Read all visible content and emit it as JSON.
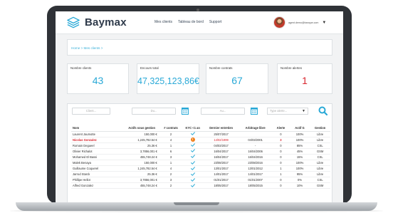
{
  "app": {
    "logo_text": "Baymax"
  },
  "nav": [
    {
      "label": "Mes clients"
    },
    {
      "label": "Tableau de bord"
    },
    {
      "label": "Support"
    }
  ],
  "user": {
    "email": "agent.demo@banque.com",
    "caret": "▼"
  },
  "breadcrumb": "Home > Mes clients >",
  "stats": [
    {
      "label": "Nombre clients",
      "value": "43"
    },
    {
      "label": "Encours total",
      "value": "47,325,123,86€"
    },
    {
      "label": "Nombre contrats",
      "value": "67"
    },
    {
      "label": "Nombre alertes",
      "value": "1"
    }
  ],
  "filters": {
    "client_placeholder": "Client...",
    "du_placeholder": "Du...",
    "au_placeholder": "Au...",
    "type_alerte_placeholder": "Type alerte...",
    "type_alerte_caret": "▼"
  },
  "table": {
    "headers": [
      "Nom",
      "Actifs sous gestion",
      "# contrats",
      "KYC <1 an",
      "Dernier entretien",
      "Arbitrage libre",
      "Alerte",
      "Actif G",
      "Gestion"
    ],
    "rows": [
      {
        "nom": "Laurent Jaumotte",
        "actifs": "150,000 €",
        "contrats": "2",
        "kyc": "check",
        "entretien": "25/07/2017",
        "arbitrage": "",
        "alerte": "0",
        "actifg": "100%",
        "gestion": "Libre"
      },
      {
        "nom": "Nicolas Gonzalez",
        "actifs": "1,245,782.54 €",
        "contrats": "4",
        "kyc": "warning",
        "entretien": "14/02/1999",
        "arbitrage": "04/03/2001",
        "alerte": "3",
        "actifg": "100%",
        "gestion": "Libre"
      },
      {
        "nom": "Romain Degueel",
        "actifs": "25.36 €",
        "contrats": "1",
        "kyc": "check",
        "entretien": "04/03/2017",
        "arbitrage": "-",
        "alerte": "0",
        "actifg": "85%",
        "gestion": "CSL"
      },
      {
        "nom": "Olivier Richalot",
        "actifs": "3,7856,001 €",
        "contrats": "6",
        "kyc": "check",
        "entretien": "16/04/2017",
        "arbitrage": "16/04/2006",
        "alerte": "0",
        "actifg": "45%",
        "gestion": "GSM"
      },
      {
        "nom": "Mohamed El Bassi",
        "actifs": "455,748.24 €",
        "contrats": "3",
        "kyc": "check",
        "entretien": "16/04/2017",
        "arbitrage": "16/04/2016",
        "alerte": "0",
        "actifg": "15%",
        "gestion": "CSL"
      },
      {
        "nom": "Malek Benaya",
        "actifs": "150,000 €",
        "contrats": "1",
        "kyc": "check",
        "entretien": "23/08/2017",
        "arbitrage": "23/08/2016",
        "alerte": "0",
        "actifg": "100%",
        "gestion": "Libre"
      },
      {
        "nom": "Guillaume Coquerel",
        "actifs": "1,245,782.54 €",
        "contrats": "4",
        "kyc": "check",
        "entretien": "13/01/2017",
        "arbitrage": "13/01/2012",
        "alerte": "1",
        "actifg": "100%",
        "gestion": "Libre"
      },
      {
        "nom": "Jarrod Starck",
        "actifs": "25.36 €",
        "contrats": "2",
        "kyc": "check",
        "entretien": "14/01/2017",
        "arbitrage": "14/01/2017",
        "alerte": "1",
        "actifg": "95%",
        "gestion": "Libre"
      },
      {
        "nom": "Phillipe Hellot",
        "actifs": "3,7856,001 €",
        "contrats": "3",
        "kyc": "check",
        "entretien": "01/01/2017",
        "arbitrage": "01/01/2007",
        "alerte": "0",
        "actifg": "0%",
        "gestion": "CSL"
      },
      {
        "nom": "Alfred Gonzalez",
        "actifs": "455,748.24 €",
        "contrats": "2",
        "kyc": "check",
        "entretien": "18/05/2017",
        "arbitrage": "18/05/2015",
        "alerte": "0",
        "actifg": "10%",
        "gestion": "GSM"
      }
    ]
  },
  "colors": {
    "accent": "#2aa9d7",
    "alert": "#d9262e",
    "check": "#3ab0d8",
    "warning": "#f07f1a",
    "brand_dark": "#2e3a4a"
  }
}
